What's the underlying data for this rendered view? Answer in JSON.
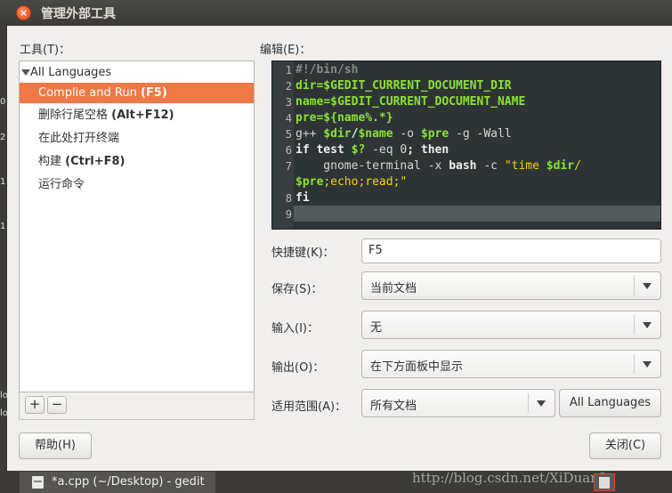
{
  "window": {
    "title": "管理外部工具",
    "close_icon": "close-icon"
  },
  "left_strip": [
    "lo",
    "lo",
    "0",
    "2",
    "1",
    "1"
  ],
  "tools": {
    "label": "工具(T)：",
    "category": "All Languages",
    "items": [
      {
        "label": "Complie and Run ",
        "accel": "(F5)",
        "selected": true
      },
      {
        "label": "删除行尾空格 ",
        "accel": "(Alt+F12)",
        "selected": false
      },
      {
        "label": "在此处打开终端",
        "accel": "",
        "selected": false
      },
      {
        "label": "构建 ",
        "accel": "(Ctrl+F8)",
        "selected": false
      },
      {
        "label": "运行命令",
        "accel": "",
        "selected": false
      }
    ],
    "add_label": "+",
    "remove_label": "−"
  },
  "editor": {
    "label": "编辑(E)：",
    "line_numbers": [
      "1",
      "2",
      "3",
      "4",
      "5",
      "6",
      "7",
      "",
      "8",
      "9"
    ],
    "current_line": 9
  },
  "shortcut": {
    "label": "快捷键(K)：",
    "value": "F5"
  },
  "save": {
    "label": "保存(S)：",
    "value": "当前文档"
  },
  "input": {
    "label": "输入(I)：",
    "value": "无"
  },
  "output": {
    "label": "输出(O)：",
    "value": "在下方面板中显示"
  },
  "applicability": {
    "label": "适用范围(A)：",
    "value": "所有文档",
    "language_button": "All Languages"
  },
  "buttons": {
    "help": "帮助(H)",
    "close": "关闭(C)"
  },
  "taskbar": {
    "item": "*a.cpp (~/Desktop) - gedit",
    "watermark": "http://blog.csdn.net/XiDuan2"
  },
  "colors": {
    "selection": "#f07746",
    "editor_bg": "#2e3436",
    "keyword": "#8ae234",
    "string": "#edd400"
  }
}
